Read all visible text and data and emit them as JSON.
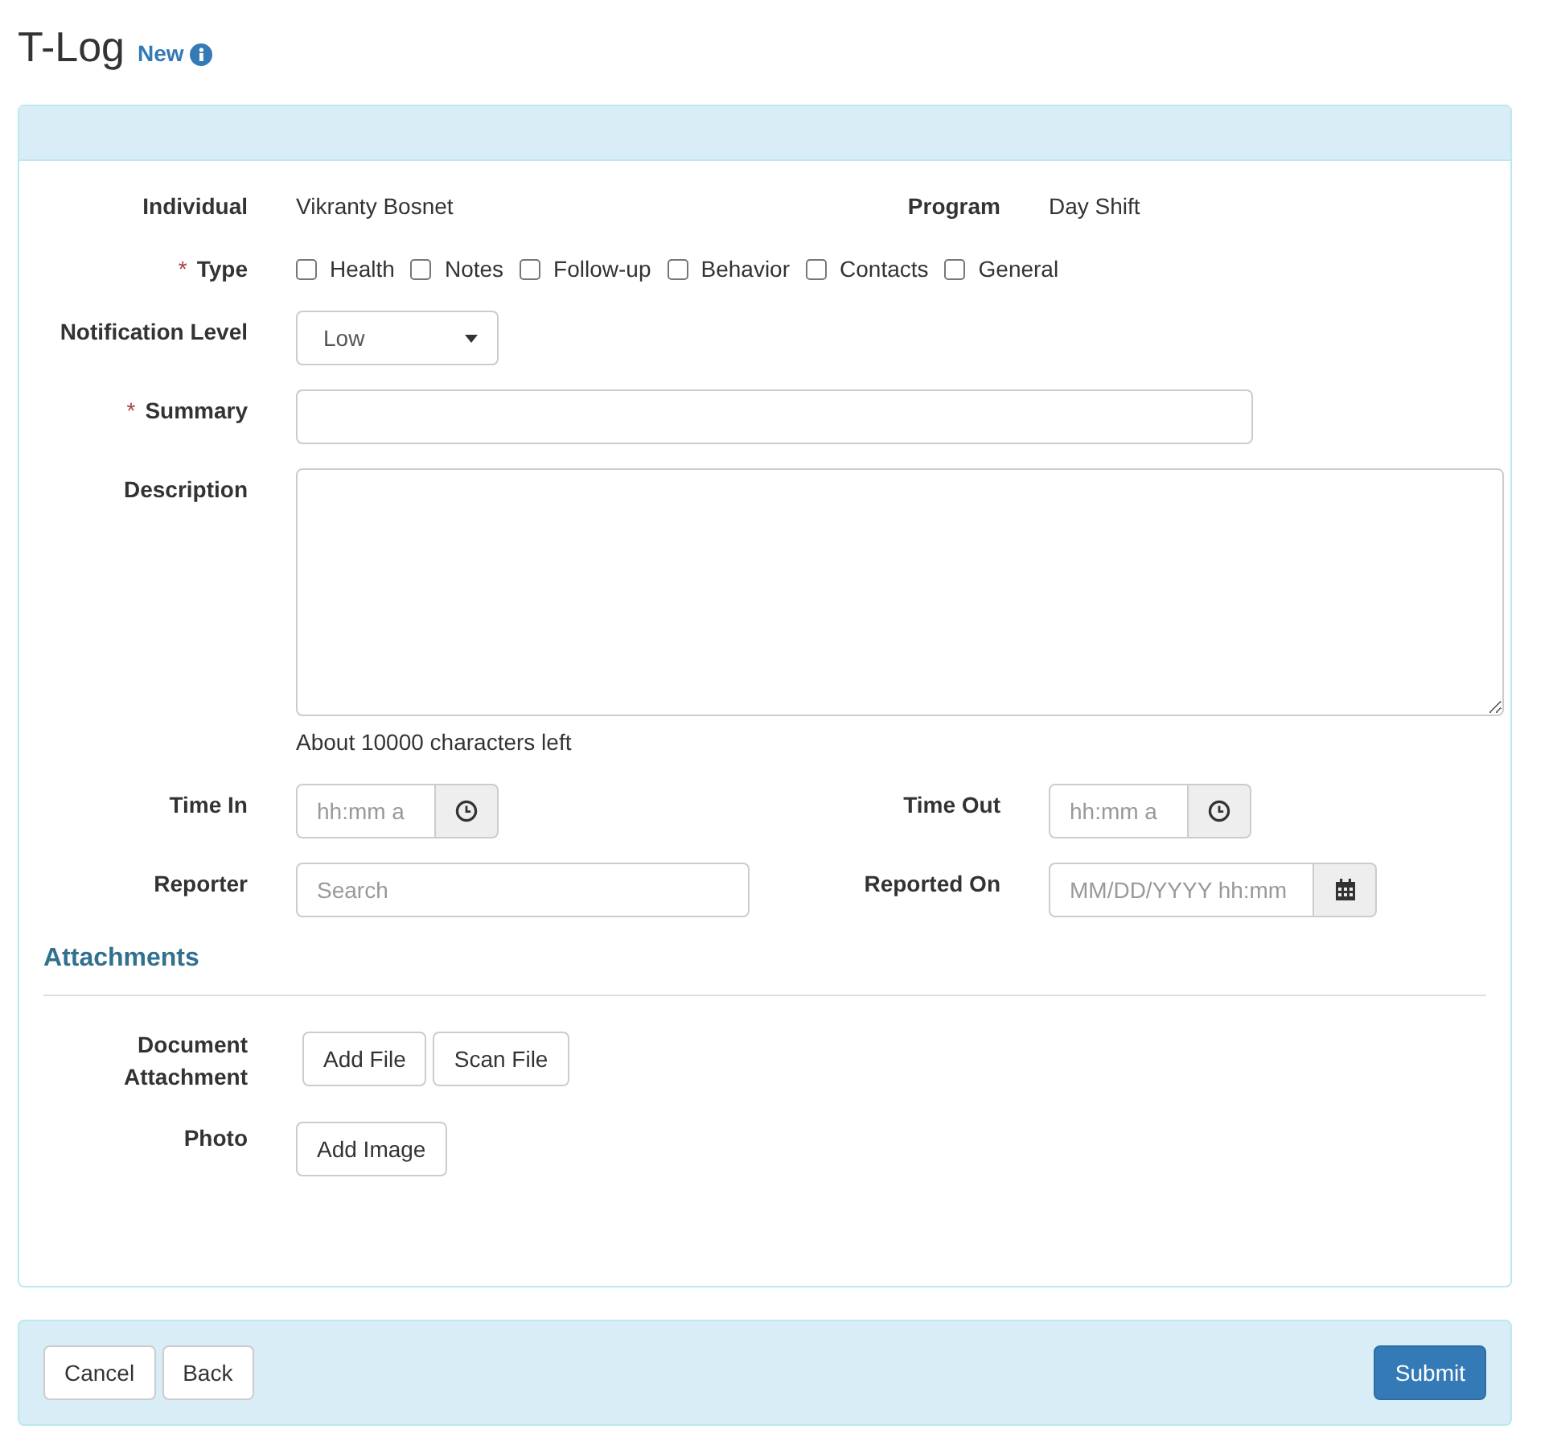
{
  "page_title": "T-Log",
  "status": "New",
  "rows": [
    {
      "fields": [
        {
          "kind": "text",
          "label": "Individual",
          "value": "Vikranty Bosnet"
        },
        {
          "kind": "text",
          "label": "Program",
          "value": "Day Shift"
        }
      ]
    },
    {
      "fields": [
        {
          "kind": "checkboxes",
          "label": "Type",
          "required_mark": "*",
          "options": [
            {
              "label": "Health",
              "checked": false
            },
            {
              "label": "Notes",
              "checked": false
            },
            {
              "label": "Follow-up",
              "checked": false
            },
            {
              "label": "Behavior",
              "checked": false
            },
            {
              "label": "Contacts",
              "checked": false
            },
            {
              "label": "General",
              "checked": false
            }
          ]
        }
      ]
    },
    {
      "fields": [
        {
          "kind": "select",
          "label": "Notification Level",
          "value": "Low"
        }
      ]
    },
    {
      "fields": [
        {
          "kind": "input",
          "label": "Summary",
          "required_mark": "*"
        }
      ]
    },
    {
      "fields": [
        {
          "kind": "textarea",
          "label": "Description",
          "help": "About 10000 characters left"
        }
      ]
    },
    {
      "fields": [
        {
          "kind": "time",
          "label": "Time In",
          "placeholder": "hh:mm a"
        },
        {
          "kind": "time",
          "label": "Time Out",
          "placeholder": "hh:mm a"
        }
      ]
    },
    {
      "fields": [
        {
          "kind": "search",
          "label": "Reporter",
          "placeholder": "Search"
        },
        {
          "kind": "datetime",
          "label": "Reported On",
          "placeholder": "MM/DD/YYYY hh:mm"
        }
      ]
    }
  ],
  "attachments": {
    "title": "Attachments",
    "rows": [
      {
        "label": "Document Attachment",
        "buttons": [
          "Add File",
          "Scan File"
        ]
      },
      {
        "label": "Photo",
        "buttons": [
          "Add Image"
        ]
      }
    ]
  },
  "footer": {
    "left_buttons": [
      "Cancel",
      "Back"
    ],
    "submit": "Submit"
  }
}
